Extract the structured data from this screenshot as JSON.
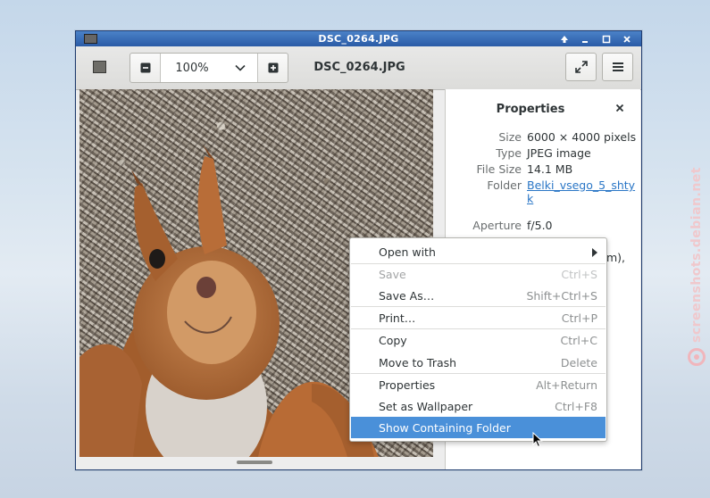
{
  "window": {
    "title": "DSC_0264.JPG"
  },
  "toolbar": {
    "zoom_value": "100%",
    "image_title": "DSC_0264.JPG"
  },
  "properties": {
    "heading": "Properties",
    "rows": [
      {
        "key": "Size",
        "value": "6000 × 4000 pixels"
      },
      {
        "key": "Type",
        "value": "JPEG image"
      },
      {
        "key": "File Size",
        "value": "14.1 MB"
      },
      {
        "key": "Folder",
        "value": "Belki_vsego_5_shtyk"
      },
      {
        "key": "Aperture",
        "value": "f/5.0"
      }
    ],
    "partial_value": "m),"
  },
  "context_menu": {
    "items": [
      {
        "label": "Open with",
        "accel": "",
        "submenu": true,
        "enabled": true
      },
      {
        "label": "Save",
        "accel": "Ctrl+S",
        "enabled": false
      },
      {
        "label": "Save As…",
        "accel": "Shift+Ctrl+S",
        "enabled": true
      },
      {
        "label": "Print…",
        "accel": "Ctrl+P",
        "enabled": true
      },
      {
        "label": "Copy",
        "accel": "Ctrl+C",
        "enabled": true
      },
      {
        "label": "Move to Trash",
        "accel": "Delete",
        "enabled": true
      },
      {
        "label": "Properties",
        "accel": "Alt+Return",
        "enabled": true
      },
      {
        "label": "Set as Wallpaper",
        "accel": "Ctrl+F8",
        "enabled": true
      },
      {
        "label": "Show Containing Folder",
        "accel": "",
        "enabled": true,
        "highlighted": true
      }
    ]
  },
  "watermark": "screenshots.debian.net",
  "colors": {
    "titlebar": "#2a5ba6",
    "highlight": "#4a90d9",
    "link": "#2a76c6"
  }
}
